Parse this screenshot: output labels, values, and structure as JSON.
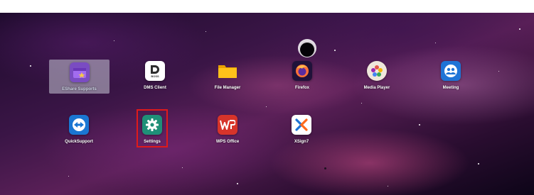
{
  "apps": [
    {
      "label": "EShare Supports",
      "icon": "eshare-icon",
      "color": "#7a4cc2",
      "selected": true
    },
    {
      "label": "DMS Client",
      "icon": "dms-client-icon",
      "color": "#2d2d2d",
      "sublabel": "BOSS"
    },
    {
      "label": "File Manager",
      "icon": "folder-icon",
      "color": "#f4b400"
    },
    {
      "label": "Firefox",
      "icon": "firefox-icon",
      "color": "#20123a"
    },
    {
      "label": "Media Player",
      "icon": "media-player-icon",
      "color": "#e9e1d6"
    },
    {
      "label": "Meeting",
      "icon": "meeting-icon",
      "color": "#1f74d6"
    },
    {
      "label": "QuickSupport",
      "icon": "quicksupport-icon",
      "color": "#1a76d2"
    },
    {
      "label": "Settings",
      "icon": "settings-gear-icon",
      "color": "#1f8f78",
      "highlighted": true
    },
    {
      "label": "WPS Office",
      "icon": "wps-office-icon",
      "color": "#d7342a"
    },
    {
      "label": "XSign7",
      "icon": "xsign-icon",
      "color": "#ffffff"
    }
  ]
}
